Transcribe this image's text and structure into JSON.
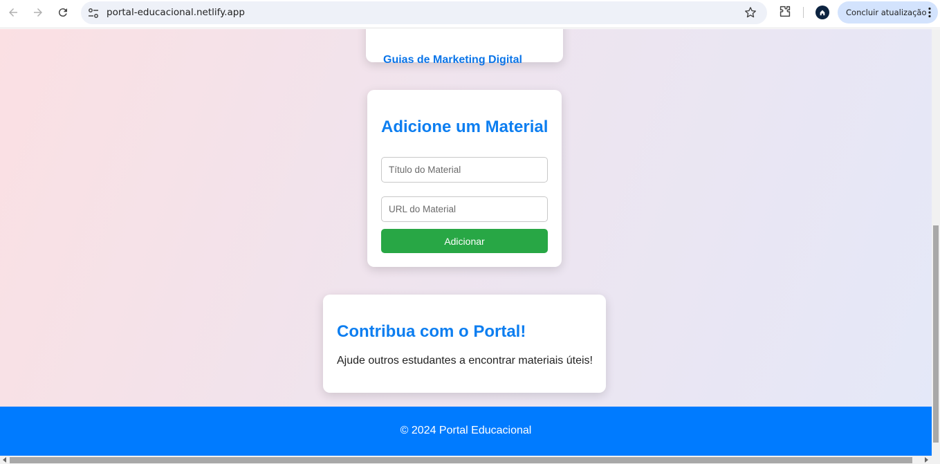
{
  "browser": {
    "url": "portal-educacional.netlify.app",
    "update_label": "Concluir atualização"
  },
  "page": {
    "top_card": {
      "link": "Guias de Marketing Digital"
    },
    "add_card": {
      "title": "Adicione um Material",
      "title_placeholder": "Título do Material",
      "url_placeholder": "URL do Material",
      "button": "Adicionar"
    },
    "contrib_card": {
      "title": "Contribua com o Portal!",
      "text": "Ajude outros estudantes a encontrar materiais úteis!"
    },
    "footer": "© 2024 Portal Educacional"
  },
  "colors": {
    "accent": "#0d7ef0",
    "button": "#28a745",
    "footer": "#007bff"
  }
}
